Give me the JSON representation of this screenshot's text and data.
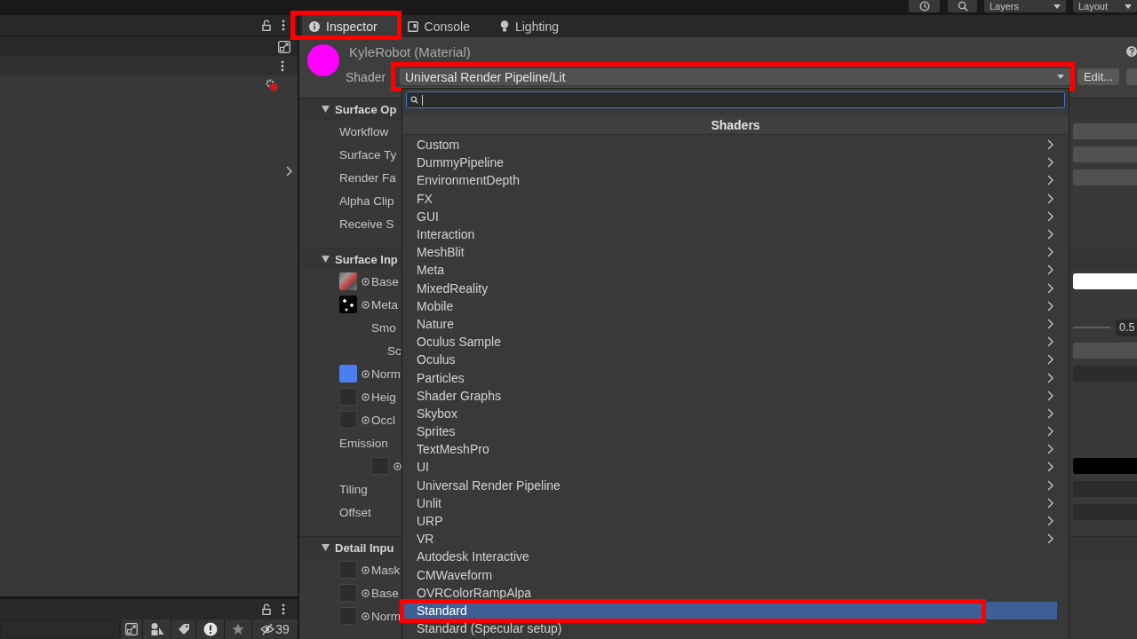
{
  "top_toolbar": {
    "layers_dropdown": "Layers",
    "layout_dropdown": "Layout"
  },
  "inspector": {
    "tabs": [
      {
        "label": "Inspector",
        "selected": true,
        "highlighted": true
      },
      {
        "label": "Console",
        "selected": false,
        "highlighted": false
      },
      {
        "label": "Lighting",
        "selected": false,
        "highlighted": false
      }
    ],
    "material": {
      "title": "KyleRobot (Material)",
      "shader_label": "Shader",
      "shader": "Universal Render Pipeline/Lit",
      "shader_highlighted": true,
      "edit_button": "Edit..."
    },
    "sections": [
      {
        "title": "Surface Op",
        "expanded": true,
        "rows": [
          {
            "label": "Workflow",
            "kind": "dropdown"
          },
          {
            "label": "Surface Ty",
            "kind": "dropdown"
          },
          {
            "label": "Render Fa",
            "kind": "dropdown"
          },
          {
            "label": "Alpha Clip",
            "kind": "label"
          },
          {
            "label": "Receive S",
            "kind": "label"
          }
        ]
      },
      {
        "title": "Surface Inp",
        "expanded": true,
        "rows": [
          {
            "label": "Base",
            "kind": "color",
            "texture": {
              "kind": "albedo"
            },
            "color": "#ffffff"
          },
          {
            "label": "Meta",
            "kind": "label",
            "texture": {
              "kind": "metallic"
            },
            "children": [
              {
                "label": "Smo",
                "kind": "slider",
                "value": "0.5",
                "children": [
                  {
                    "label": "Sc",
                    "kind": "dropdown"
                  }
                ]
              }
            ]
          },
          {
            "label": "Norm",
            "kind": "number",
            "texture": {
              "kind": "normal"
            }
          },
          {
            "label": "Heig",
            "kind": "label",
            "texture": {
              "kind": "empty"
            }
          },
          {
            "label": "Occl",
            "kind": "label",
            "texture": {
              "kind": "empty"
            }
          },
          {
            "label": "Emission",
            "kind": "label",
            "children": [
              {
                "kind": "color",
                "texture": {
                  "kind": "empty"
                },
                "color": "#000000"
              }
            ]
          },
          {
            "label": "Tiling",
            "kind": "number"
          },
          {
            "label": "Offset",
            "kind": "number"
          }
        ]
      },
      {
        "title": "Detail Inpu",
        "expanded": true,
        "rows": [
          {
            "label": "Mask",
            "kind": "label",
            "texture": {
              "kind": "empty"
            }
          },
          {
            "label": "Base",
            "kind": "label",
            "texture": {
              "kind": "empty"
            }
          },
          {
            "label": "Norm",
            "kind": "label",
            "texture": {
              "kind": "empty"
            }
          }
        ]
      }
    ]
  },
  "shader_menu": {
    "title": "Shaders",
    "items": [
      {
        "label": "Custom",
        "kind": "folder",
        "selected": false,
        "highlighted": false
      },
      {
        "label": "DummyPipeline",
        "kind": "folder",
        "selected": false,
        "highlighted": false
      },
      {
        "label": "EnvironmentDepth",
        "kind": "folder",
        "selected": false,
        "highlighted": false
      },
      {
        "label": "FX",
        "kind": "folder",
        "selected": false,
        "highlighted": false
      },
      {
        "label": "GUI",
        "kind": "folder",
        "selected": false,
        "highlighted": false
      },
      {
        "label": "Interaction",
        "kind": "folder",
        "selected": false,
        "highlighted": false
      },
      {
        "label": "MeshBlit",
        "kind": "folder",
        "selected": false,
        "highlighted": false
      },
      {
        "label": "Meta",
        "kind": "folder",
        "selected": false,
        "highlighted": false
      },
      {
        "label": "MixedReality",
        "kind": "folder",
        "selected": false,
        "highlighted": false
      },
      {
        "label": "Mobile",
        "kind": "folder",
        "selected": false,
        "highlighted": false
      },
      {
        "label": "Nature",
        "kind": "folder",
        "selected": false,
        "highlighted": false
      },
      {
        "label": "Oculus Sample",
        "kind": "folder",
        "selected": false,
        "highlighted": false
      },
      {
        "label": "Oculus",
        "kind": "folder",
        "selected": false,
        "highlighted": false
      },
      {
        "label": "Particles",
        "kind": "folder",
        "selected": false,
        "highlighted": false
      },
      {
        "label": "Shader Graphs",
        "kind": "folder",
        "selected": false,
        "highlighted": false
      },
      {
        "label": "Skybox",
        "kind": "folder",
        "selected": false,
        "highlighted": false
      },
      {
        "label": "Sprites",
        "kind": "folder",
        "selected": false,
        "highlighted": false
      },
      {
        "label": "TextMeshPro",
        "kind": "folder",
        "selected": false,
        "highlighted": false
      },
      {
        "label": "UI",
        "kind": "folder",
        "selected": false,
        "highlighted": false
      },
      {
        "label": "Universal Render Pipeline",
        "kind": "folder",
        "selected": false,
        "highlighted": false
      },
      {
        "label": "Unlit",
        "kind": "folder",
        "selected": false,
        "highlighted": false
      },
      {
        "label": "URP",
        "kind": "folder",
        "selected": false,
        "highlighted": false
      },
      {
        "label": "VR",
        "kind": "folder",
        "selected": false,
        "highlighted": false
      },
      {
        "label": "Autodesk Interactive",
        "kind": "shader",
        "selected": false,
        "highlighted": false
      },
      {
        "label": "CMWaveform",
        "kind": "shader",
        "selected": false,
        "highlighted": false
      },
      {
        "label": "OVRColorRampAlpa",
        "kind": "shader",
        "selected": false,
        "highlighted": false
      },
      {
        "label": "Standard",
        "kind": "shader",
        "selected": true,
        "highlighted": true
      },
      {
        "label": "Standard (Specular setup)",
        "kind": "shader",
        "selected": false,
        "highlighted": false
      }
    ]
  },
  "project_toolbar": {
    "hidden_count": "39"
  }
}
